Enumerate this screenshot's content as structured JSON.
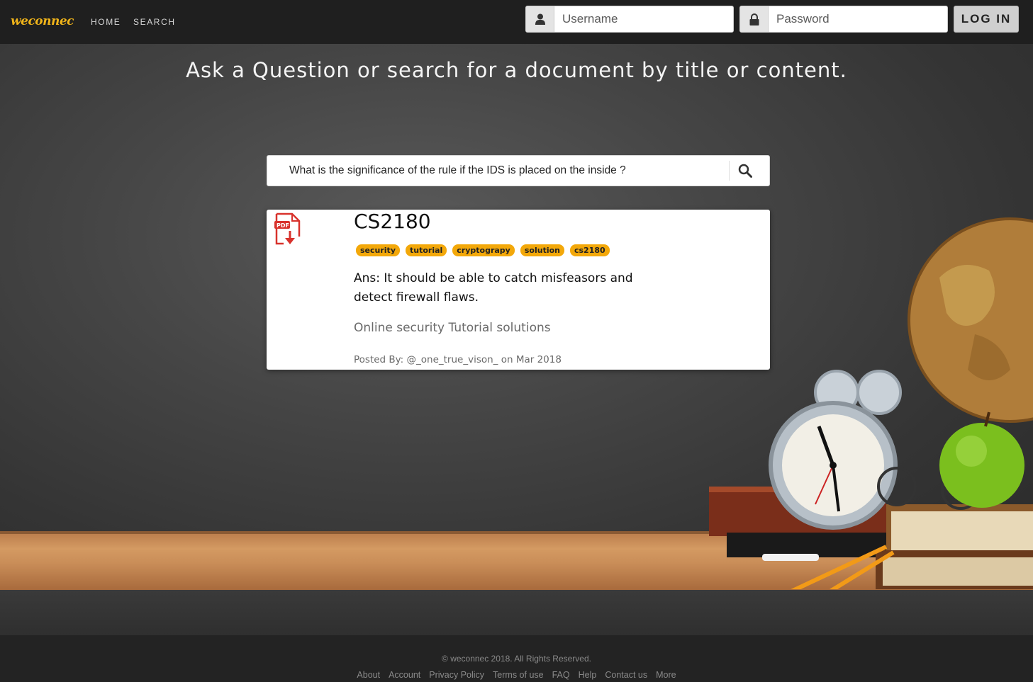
{
  "nav": {
    "brand": "weconnec",
    "links": [
      "HOME",
      "SEARCH"
    ],
    "username_placeholder": "Username",
    "password_placeholder": "Password",
    "login_label": "LOG IN",
    "user_icon": "user-icon",
    "lock_icon": "lock-icon"
  },
  "hero": {
    "heading": "Ask a Question or search for a document by title or content."
  },
  "search": {
    "value": "What is the significance of the rule if the IDS is placed on the inside ?",
    "icon": "search-icon"
  },
  "result": {
    "file_icon": "pdf-file-icon",
    "title": "CS2180",
    "tags": [
      "security",
      "tutorial",
      "cryptograpy",
      "solution",
      "cs2180"
    ],
    "answer": "Ans: It should be able to catch misfeasors and detect firewall flaws.",
    "description": "Online security Tutorial solutions",
    "posted": "Posted By: @_one_true_vison_ on Mar 2018"
  },
  "footer": {
    "copyright": "© weconnec 2018. All Rights Reserved.",
    "links": [
      "About",
      "Account",
      "Privacy Policy",
      "Terms of use",
      "FAQ",
      "Help",
      "Contact us",
      "More"
    ]
  },
  "colors": {
    "brand": "#f0b41a",
    "tag_background": "#f3a80a",
    "navbar": "#1f1f1f",
    "footer": "#232323"
  }
}
